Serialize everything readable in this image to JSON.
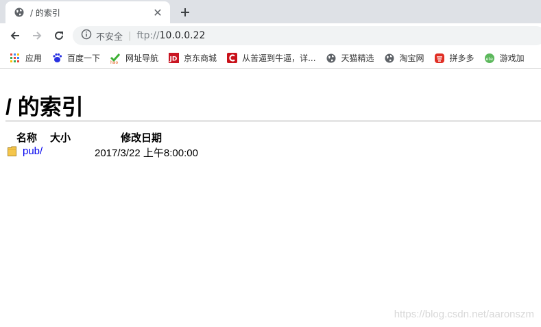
{
  "tab": {
    "title": "/ 的索引",
    "favicon": "globe-icon"
  },
  "toolbar": {
    "security_text": "不安全",
    "url_scheme": "ftp://",
    "url_host": "10.0.0.22"
  },
  "bookmarks": [
    {
      "label": "应用",
      "icon": "apps-grid-icon"
    },
    {
      "label": "百度一下",
      "icon": "baidu-icon"
    },
    {
      "label": "网址导航",
      "icon": "hao-icon"
    },
    {
      "label": "京东商城",
      "icon": "jd-icon"
    },
    {
      "label": "从苦逼到牛逼，详...",
      "icon": "csdn-icon"
    },
    {
      "label": "天猫精选",
      "icon": "globe-icon"
    },
    {
      "label": "淘宝网",
      "icon": "globe-icon"
    },
    {
      "label": "拼多多",
      "icon": "pinduoduo-icon"
    },
    {
      "label": "游戏加",
      "icon": "game-icon"
    }
  ],
  "page": {
    "heading": "/ 的索引",
    "columns": {
      "name": "名称",
      "size": "大小",
      "modified": "修改日期"
    },
    "rows": [
      {
        "name": "pub/",
        "size": "",
        "modified": "2017/3/22 上午8:00:00"
      }
    ],
    "watermark": "https://blog.csdn.net/aaronszm"
  },
  "colors": {
    "link": "#0000ee",
    "tabstrip": "#dee1e6",
    "omnibox": "#f1f3f4"
  }
}
